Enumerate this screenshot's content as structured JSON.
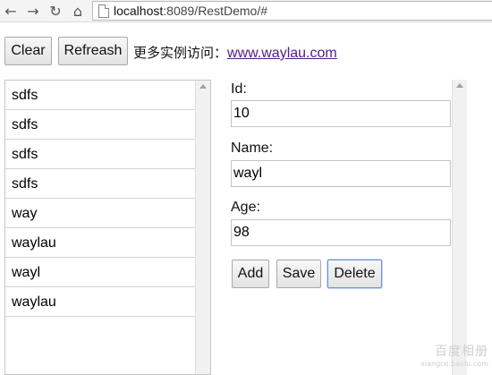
{
  "browser": {
    "url_host": "localhost",
    "url_rest": ":8089/RestDemo/#"
  },
  "toolbar": {
    "clear_label": "Clear",
    "refresh_label": "Refreash",
    "tip_text": "更多实例访问：",
    "tip_link": "www.waylau.com"
  },
  "list": {
    "items": [
      "sdfs",
      "sdfs",
      "sdfs",
      "sdfs",
      "way",
      "waylau",
      "wayl",
      "waylau"
    ]
  },
  "form": {
    "id_label": "Id:",
    "id_value": "10",
    "name_label": "Name:",
    "name_value": "wayl",
    "age_label": "Age:",
    "age_value": "98",
    "add_label": "Add",
    "save_label": "Save",
    "delete_label": "Delete"
  },
  "watermark": {
    "main": "百度相册",
    "sub": "xiangce.baidu.com"
  }
}
